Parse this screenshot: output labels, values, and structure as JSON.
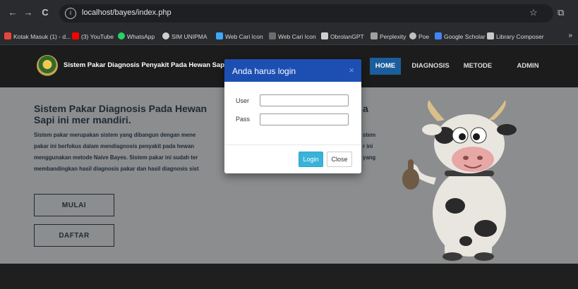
{
  "browser": {
    "url": "localhost/bayes/index.php",
    "nav": {
      "back": "←",
      "forward": "→",
      "reload": "C"
    },
    "bookmarks": [
      {
        "label": "Kotak Masuk (1) - d...",
        "color": "#e8453c"
      },
      {
        "label": "(3) YouTube",
        "color": "#ff0000"
      },
      {
        "label": "WhatsApp",
        "color": "#25d366"
      },
      {
        "label": "SIM UNIPMA",
        "color": "#cfcfcf"
      },
      {
        "label": "Web Cari Icon",
        "color": "#3da9fc"
      },
      {
        "label": "Web Cari Icon",
        "color": "#6c6c6c"
      },
      {
        "label": "ObrolanGPT",
        "color": "#d0d0d0"
      },
      {
        "label": "Perplexity",
        "color": "#a0a0a0"
      },
      {
        "label": "Poe",
        "color": "#c0c0c0"
      },
      {
        "label": "Google Scholar",
        "color": "#4285f4"
      },
      {
        "label": "Library Composer",
        "color": "#c9c9c9"
      }
    ],
    "more": "»"
  },
  "site": {
    "brand": "Sistem Pakar Diagnosis Penyakit Pada Hewan Sap",
    "nav": [
      {
        "label": "HOME",
        "active": true
      },
      {
        "label": "DIAGNOSIS",
        "active": false
      },
      {
        "label": "METODE",
        "active": false
      },
      {
        "label": "ADMIN",
        "active": false
      }
    ]
  },
  "hero": {
    "title": "Sistem Pakar Diagnosis Pada Hewan Sapi ini mer mandiri.",
    "title_tail": "a",
    "left_lines": [
      "Sistem pakar merupakan sistem yang dibangun dengan mene",
      "pakar ini berfokus dalam mendiagnosis penyakit pada hewan",
      "menggunakan metode Naive Bayes. Sistem pakar ini sudah ter",
      "membandingkan hasil diagnosis pakar dan hasil diagnosis sist"
    ],
    "right_lines": [
      "stem",
      "r ini",
      "yang"
    ],
    "buttons": {
      "start": "MULAI",
      "register": "DAFTAR"
    }
  },
  "modal": {
    "title": "Anda harus login",
    "close_x": "×",
    "user_label": "User",
    "pass_label": "Pass",
    "user_value": "",
    "pass_value": "",
    "login_label": "Login",
    "close_label": "Close"
  },
  "colors": {
    "modal_header": "#1d4fb3",
    "login_button": "#39b3d7",
    "nav_active": "#1b5e9b"
  }
}
